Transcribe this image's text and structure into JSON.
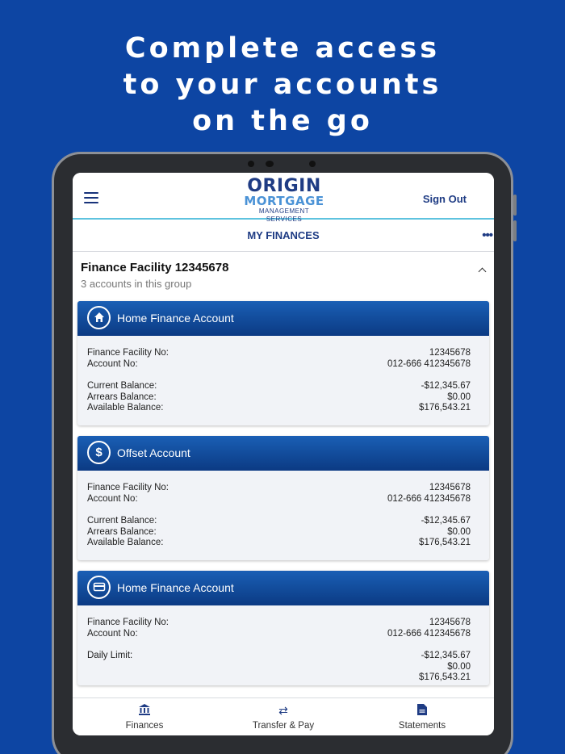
{
  "headline": [
    "Complete access",
    "to your accounts",
    "on the go"
  ],
  "app": {
    "logo": {
      "line1": "ORIGIN",
      "line2": "MORTGAGE",
      "line3": "MANAGEMENT SERVICES"
    },
    "sign_out": "Sign Out",
    "page_title": "MY FINANCES"
  },
  "group": {
    "title": "Finance Facility 12345678",
    "subtitle": "3 accounts in this group"
  },
  "cards": [
    {
      "title": "Home Finance Account",
      "icon": "home-icon",
      "facility_label": "Finance Facility No:",
      "facility_value": "12345678",
      "account_label": "Account No:",
      "account_value": "012-666 412345678",
      "current_label": "Current Balance:",
      "current_value": "-$12,345.67",
      "arrears_label": "Arrears Balance:",
      "arrears_value": "$0.00",
      "available_label": "Available Balance:",
      "available_value": "$176,543.21"
    },
    {
      "title": "Offset Account",
      "icon": "dollar-icon",
      "facility_label": "Finance Facility No:",
      "facility_value": "12345678",
      "account_label": "Account No:",
      "account_value": "012-666 412345678",
      "current_label": "Current Balance:",
      "current_value": "-$12,345.67",
      "arrears_label": "Arrears Balance:",
      "arrears_value": "$0.00",
      "available_label": "Available Balance:",
      "available_value": "$176,543.21"
    },
    {
      "title": "Home Finance Account",
      "icon": "credit-card-icon",
      "facility_label": "Finance Facility No:",
      "facility_value": "12345678",
      "account_label": "Account No:",
      "account_value": "012-666 412345678",
      "daily_label": "Daily Limit:",
      "v1": "-$12,345.67",
      "v2": "$0.00",
      "v3": "$176,543.21"
    }
  ],
  "tabs": [
    {
      "label": "Finances",
      "icon": "bank-icon"
    },
    {
      "label": "Transfer & Pay",
      "icon": "transfer-icon"
    },
    {
      "label": "Statements",
      "icon": "document-icon"
    }
  ],
  "colors": {
    "background": "#0d45a3",
    "brand": "#1f3c84",
    "accent": "#5ec3df"
  }
}
